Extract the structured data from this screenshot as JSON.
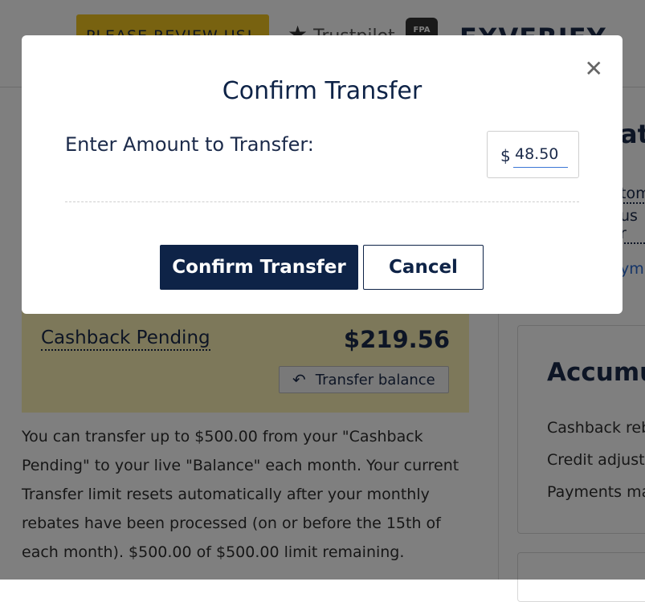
{
  "header": {
    "review_tag": "PLEASE REVIEW US!",
    "trustpilot_label": "Trustpilot",
    "fpa_badge": "FPA",
    "brand_logo": "FXVERIFY"
  },
  "cashback": {
    "title": "Cashback Pending",
    "amount": "$219.56",
    "transfer_button_label": "Transfer balance",
    "transfer_icon": "reply-arrow-icon"
  },
  "info": {
    "text": "You can transfer up to $500.00 from your \"Cashback Pending\" to your live \"Balance\" each month. Your current Transfer limit resets automatically after your monthly rebates have been processed (on or before the 15th of each month). $500.00 of $500.00 limit remaining."
  },
  "right_panel": {
    "title_partial": "at",
    "link1_partial": "tom",
    "link2_partial": "us r",
    "link3_partial": "ym",
    "accumulated": {
      "title": "Accumul",
      "items": [
        "Cashback reb",
        "Credit adjustn",
        "Payments ma"
      ]
    }
  },
  "modal": {
    "title": "Confirm Transfer",
    "close_icon": "close-icon",
    "amount_label": "Enter Amount to Transfer:",
    "currency_symbol": "$",
    "amount_value": "48.50",
    "confirm_label": "Confirm Transfer",
    "cancel_label": "Cancel"
  },
  "colors": {
    "primary": "#0e2347",
    "cashback_bg": "#fbf0b4",
    "review_tag": "#f0c420",
    "link": "#2a6ad0"
  }
}
